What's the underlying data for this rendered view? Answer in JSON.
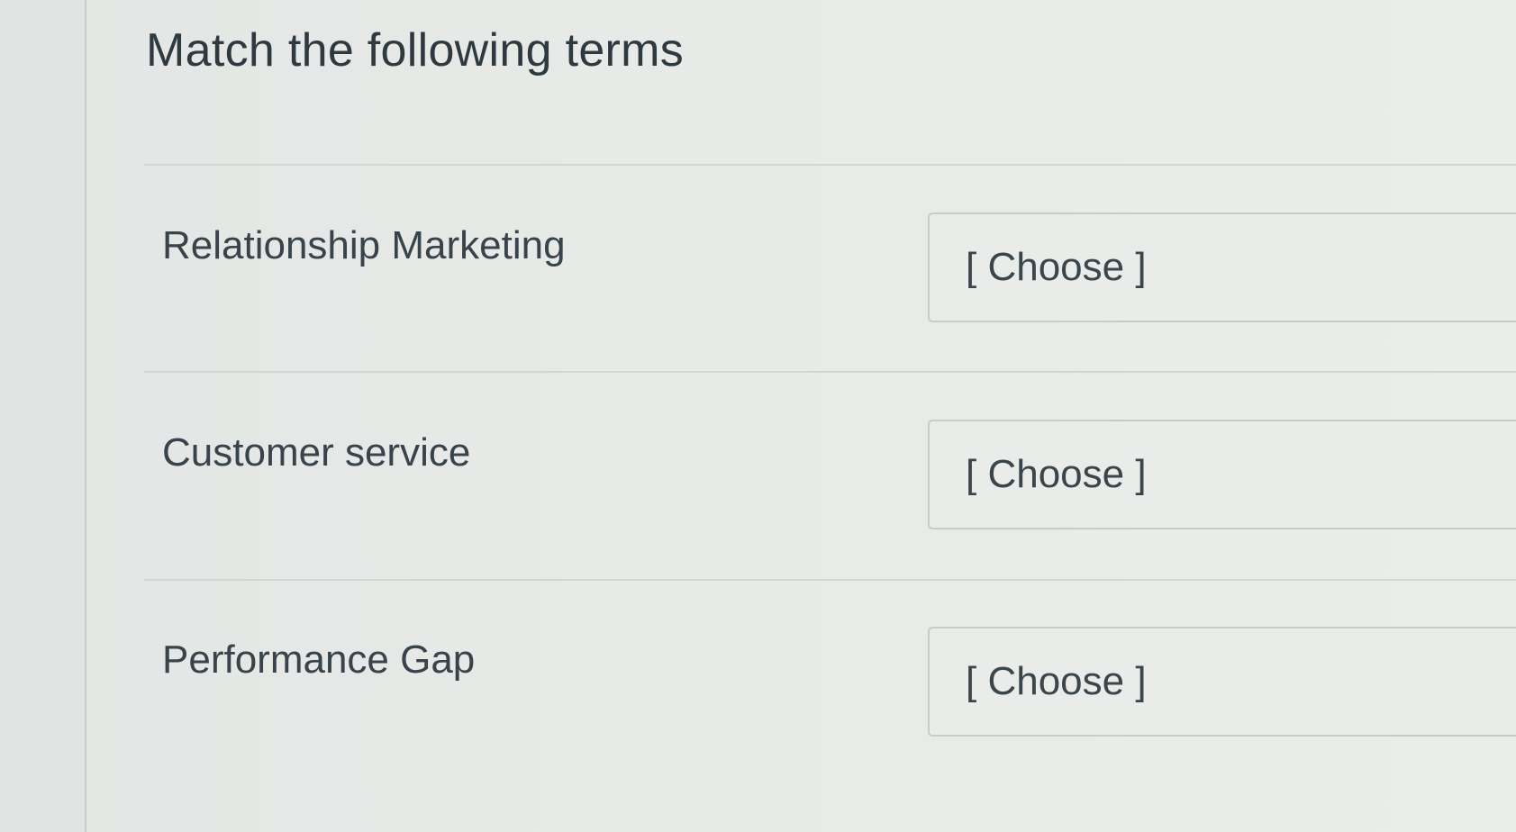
{
  "question": {
    "title": "Match the following terms"
  },
  "rows": [
    {
      "term": "Relationship Marketing",
      "selected": "[ Choose ]"
    },
    {
      "term": "Customer service",
      "selected": "[ Choose ]"
    },
    {
      "term": "Performance Gap",
      "selected": "[ Choose ]"
    }
  ]
}
